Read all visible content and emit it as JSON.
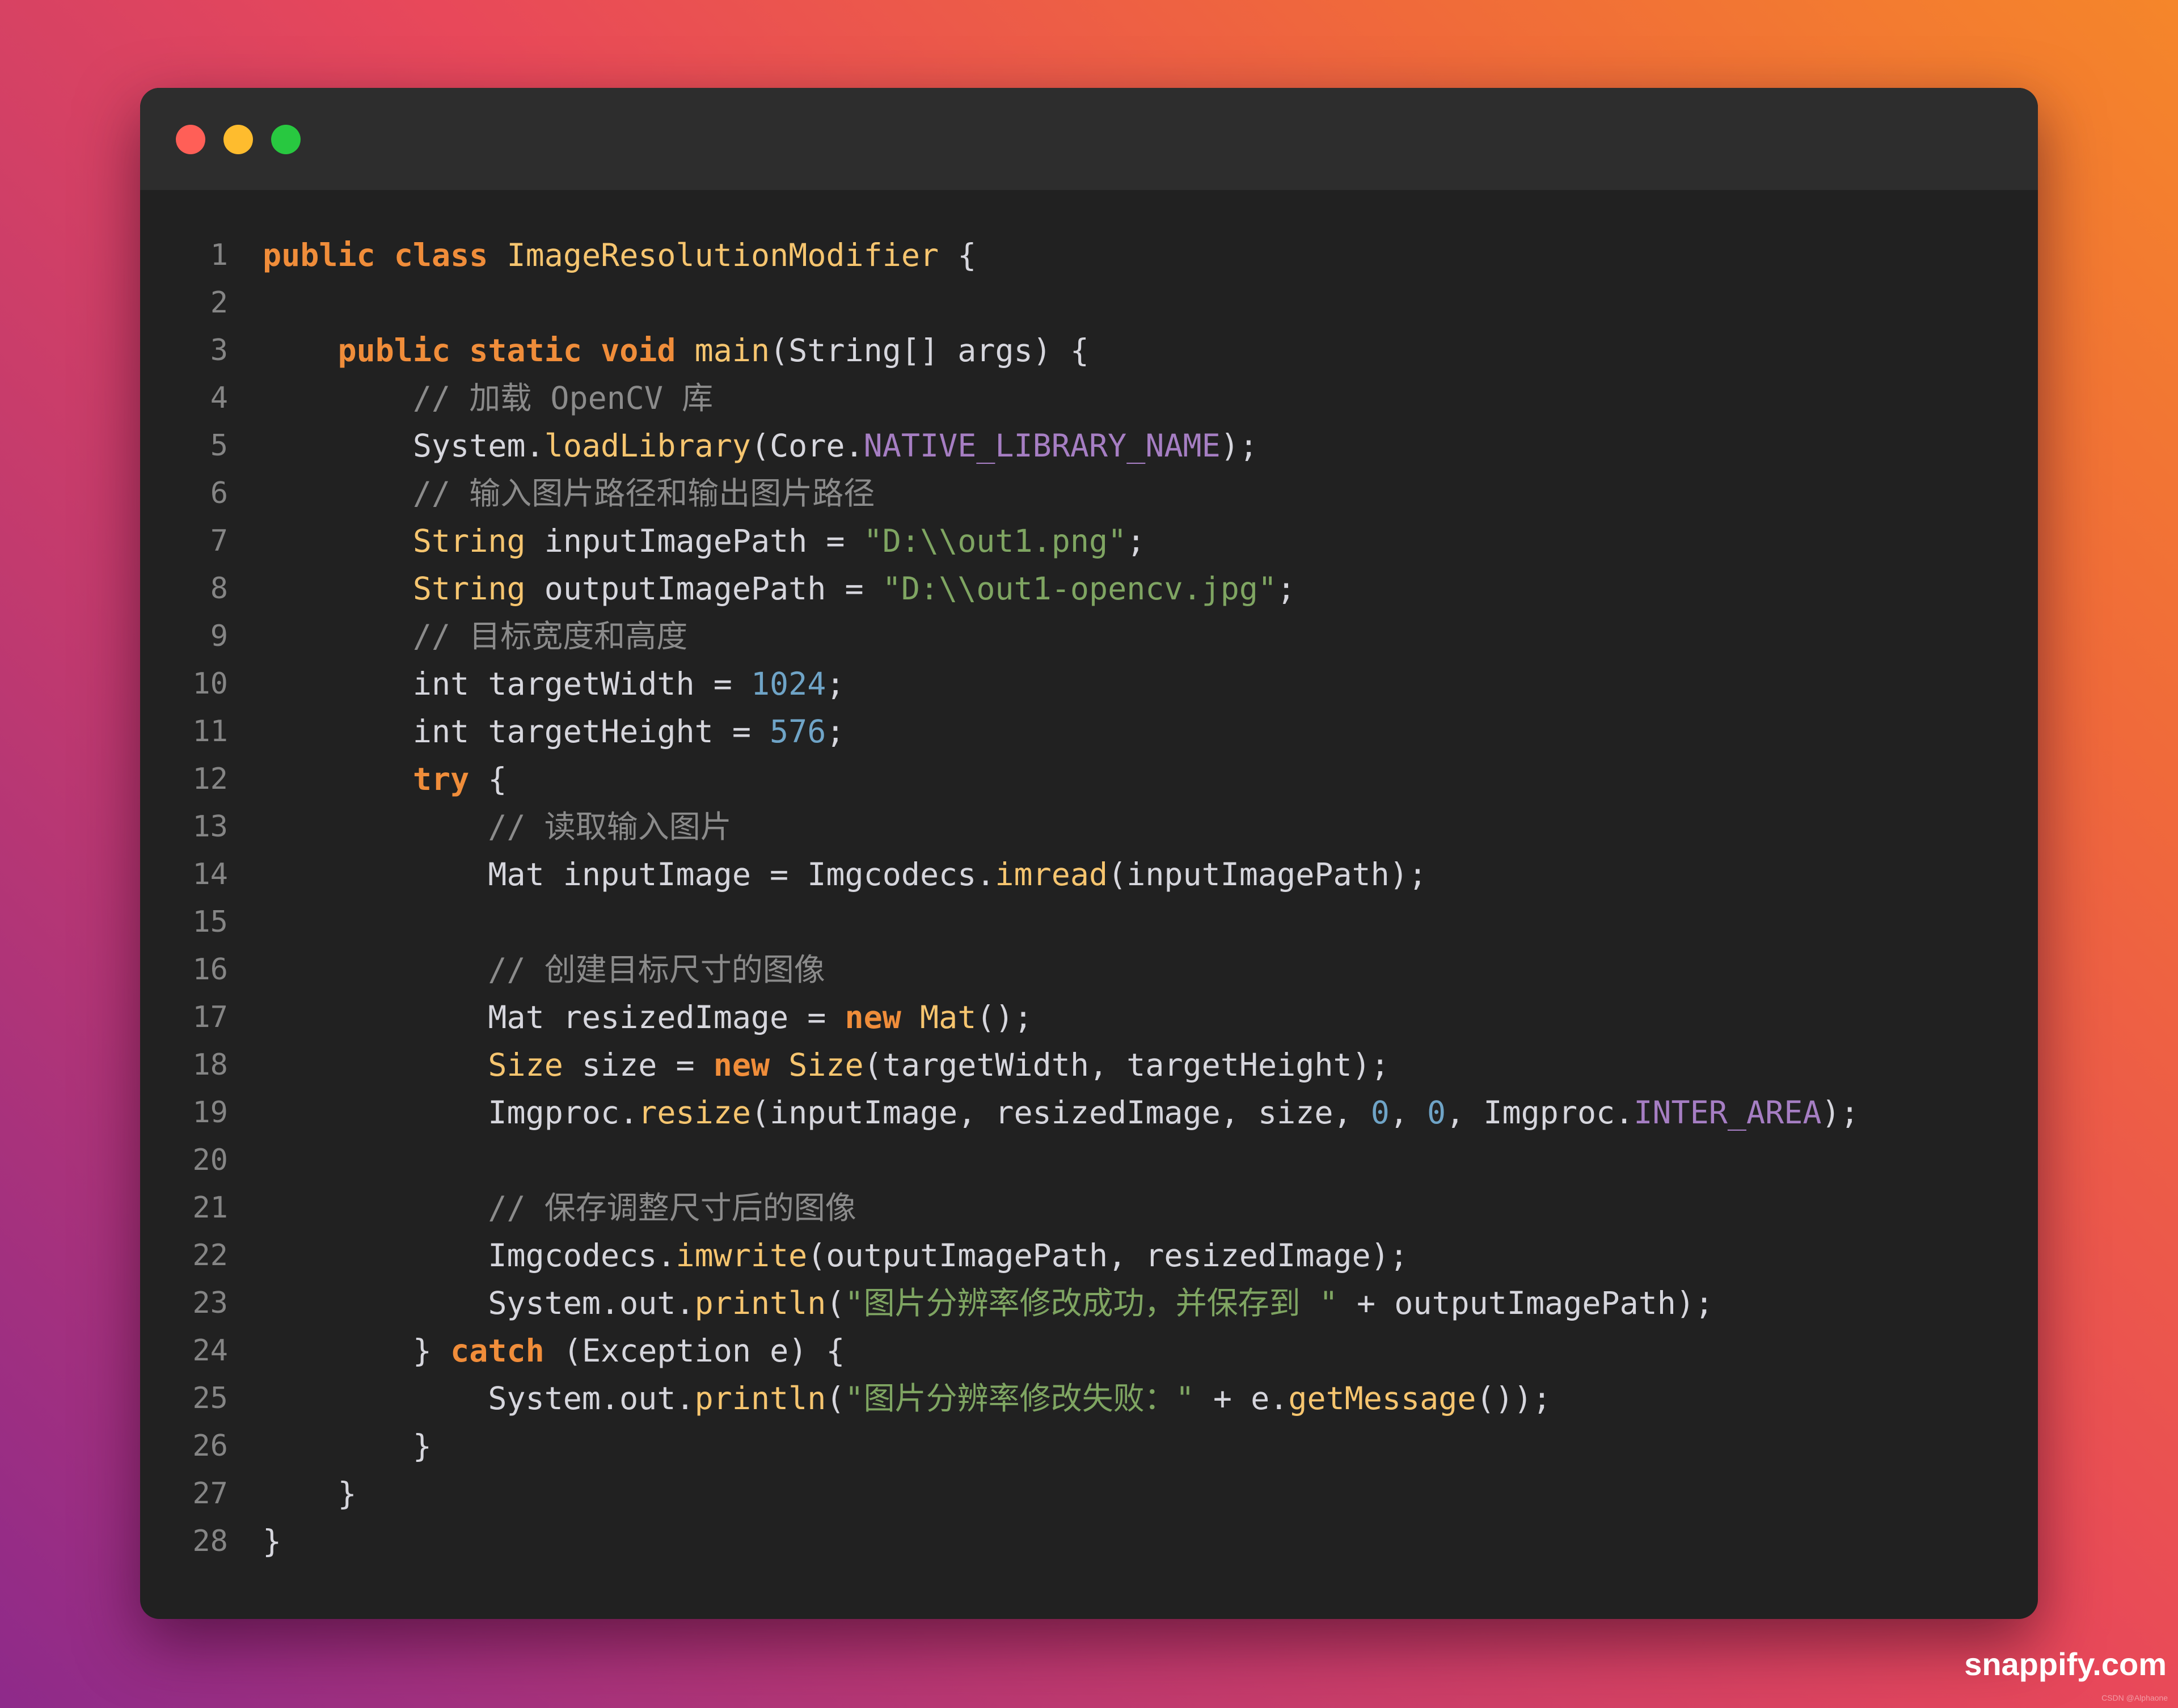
{
  "window": {
    "controls": [
      "close",
      "minimize",
      "maximize"
    ],
    "colors": {
      "close": "#ff5f57",
      "minimize": "#febc2e",
      "maximize": "#28c840",
      "background": "#212121",
      "titlebar": "#2d2d2d"
    }
  },
  "code": {
    "language": "java",
    "lines": [
      "public class ImageResolutionModifier {",
      "",
      "    public static void main(String[] args) {",
      "        // 加载 OpenCV 库",
      "        System.loadLibrary(Core.NATIVE_LIBRARY_NAME);",
      "        // 输入图片路径和输出图片路径",
      "        String inputImagePath = \"D:\\\\out1.png\";",
      "        String outputImagePath = \"D:\\\\out1-opencv.jpg\";",
      "        // 目标宽度和高度",
      "        int targetWidth = 1024;",
      "        int targetHeight = 576;",
      "        try {",
      "            // 读取输入图片",
      "            Mat inputImage = Imgcodecs.imread(inputImagePath);",
      "",
      "            // 创建目标尺寸的图像",
      "            Mat resizedImage = new Mat();",
      "            Size size = new Size(targetWidth, targetHeight);",
      "            Imgproc.resize(inputImage, resizedImage, size, 0, 0, Imgproc.INTER_AREA);",
      "",
      "            // 保存调整尺寸后的图像",
      "            Imgcodecs.imwrite(outputImagePath, resizedImage);",
      "            System.out.println(\"图片分辨率修改成功，并保存到 \" + outputImagePath);",
      "        } catch (Exception e) {",
      "            System.out.println(\"图片分辨率修改失败：\" + e.getMessage());",
      "        }",
      "    }",
      "}"
    ],
    "line_numbers": [
      "1",
      "2",
      "3",
      "4",
      "5",
      "6",
      "7",
      "8",
      "9",
      "10",
      "11",
      "12",
      "13",
      "14",
      "15",
      "16",
      "17",
      "18",
      "19",
      "20",
      "21",
      "22",
      "23",
      "24",
      "25",
      "26",
      "27",
      "28"
    ]
  },
  "branding": {
    "label": "snappify.com",
    "watermark": "CSDN @Alphaone"
  }
}
